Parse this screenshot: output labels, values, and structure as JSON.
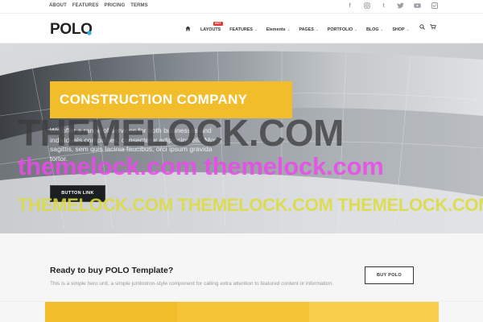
{
  "topbar": {
    "links": [
      "ABOUT",
      "FEATURES",
      "PRICING",
      "TERMS"
    ],
    "social_icons": [
      "facebook-icon",
      "instagram-icon",
      "tumblr-icon",
      "twitter-icon",
      "youtube-icon",
      "vimeo-icon"
    ]
  },
  "header": {
    "logo": "POLO",
    "nav": [
      {
        "label": "LAYOUTS",
        "badge": "HOT"
      },
      {
        "label": "FEATURES"
      },
      {
        "label": "Elements"
      },
      {
        "label": "PAGES"
      },
      {
        "label": "PORTFOLIO"
      },
      {
        "label": "BLOG"
      },
      {
        "label": "SHOP"
      }
    ],
    "icons": [
      "search-icon",
      "cart-icon"
    ]
  },
  "hero": {
    "title": "CONSTRUCTION COMPANY",
    "text": "We offer a range of services for both businesses and individuals companies, consectetur adipiscing elit. Morbi sagittis, sem quis lacinia faucibus, orci ipsum gravida tortor.",
    "button": "BUTTON LINK",
    "accent": "#f2bd2a"
  },
  "watermarks": {
    "line1": "THEMELOCK.COM",
    "line2": "themelock.com themelock.com",
    "line3": "THEMELOCK.COM THEMELOCK.COM THEMELOCK.COM"
  },
  "cta": {
    "title": "Ready to buy POLO Template?",
    "subtitle": "This is a simple hero unit, a simple jumbotron-style component for calling extra attention to featured content or information.",
    "button": "BUY POLO"
  }
}
